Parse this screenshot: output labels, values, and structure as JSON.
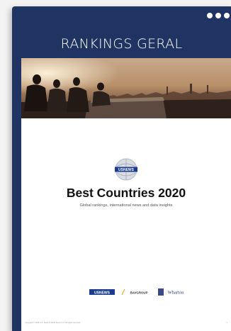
{
  "card": {
    "title": "RANKINGS GERAL"
  },
  "document": {
    "badge_text": "USNEWS",
    "heading": "Best Countries 2020",
    "subheading": "Global rankings, international news and data insights",
    "partners": [
      "USNEWS",
      "BAVGROUP",
      "Wharton"
    ],
    "copyright": "Copyright © 2020 U.S. News & World Report L.P. All rights reserved.",
    "page_number": "1"
  },
  "icons": {
    "menu": "more-horizontal-icon"
  },
  "colors": {
    "card_bg": "#1f3462",
    "page_bg": "#f3f3f3",
    "usnews_blue": "#1b3d8f"
  }
}
